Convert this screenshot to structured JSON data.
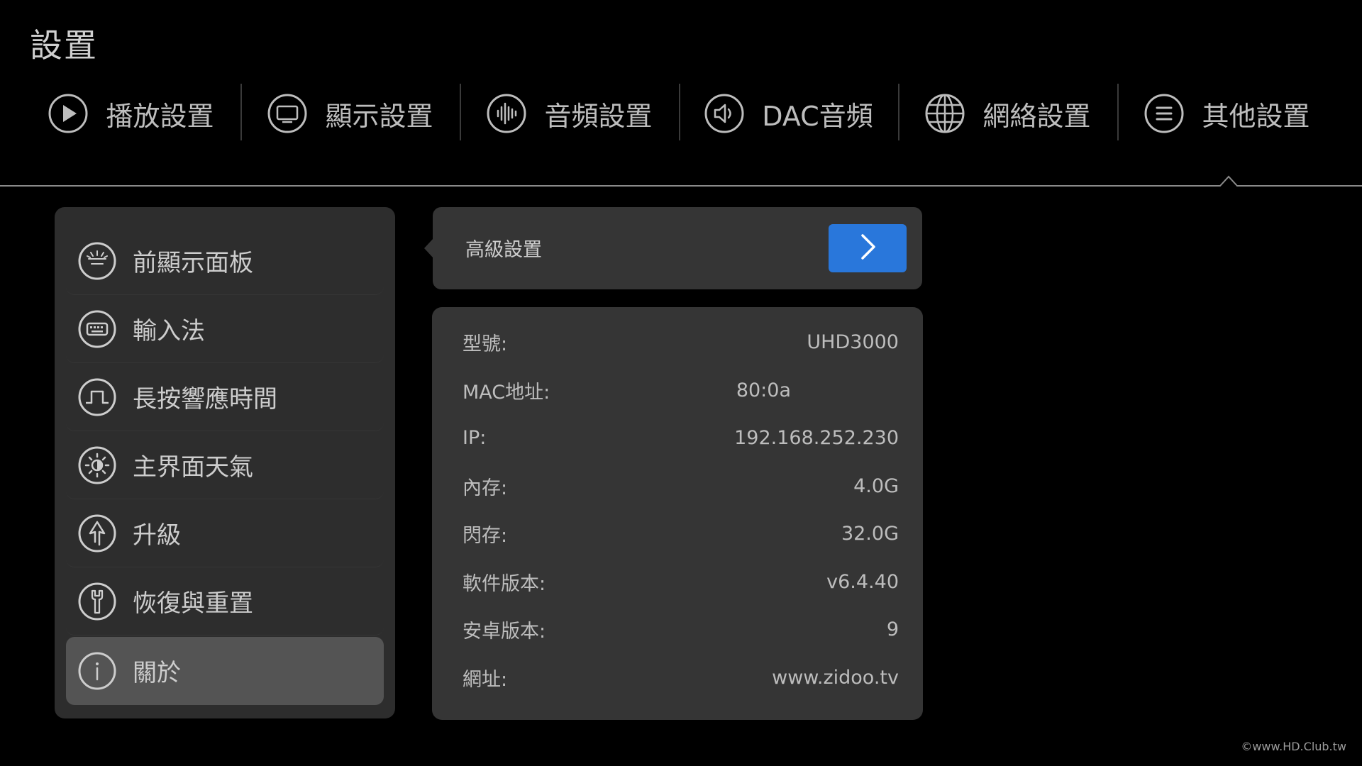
{
  "page_title": "設置",
  "tabs": [
    {
      "label": "播放設置",
      "icon": "play-icon"
    },
    {
      "label": "顯示設置",
      "icon": "monitor-icon"
    },
    {
      "label": "音頻設置",
      "icon": "audio-wave-icon"
    },
    {
      "label": "DAC音頻",
      "icon": "speaker-icon"
    },
    {
      "label": "網絡設置",
      "icon": "globe-icon"
    },
    {
      "label": "其他設置",
      "icon": "menu-icon"
    }
  ],
  "active_tab_index": 5,
  "menu": {
    "items": [
      {
        "label": "前顯示面板",
        "icon": "front-panel-icon"
      },
      {
        "label": "輸入法",
        "icon": "keyboard-icon"
      },
      {
        "label": "長按響應時間",
        "icon": "pulse-icon"
      },
      {
        "label": "主界面天氣",
        "icon": "weather-icon"
      },
      {
        "label": "升級",
        "icon": "upgrade-icon"
      },
      {
        "label": "恢復與重置",
        "icon": "wrench-icon"
      },
      {
        "label": "關於",
        "icon": "info-icon"
      }
    ],
    "active_index": 6
  },
  "advanced": {
    "label": "高級設置",
    "button_icon": "chevron-right-icon",
    "button_color": "#2977db"
  },
  "info": {
    "rows": [
      {
        "key": "型號:",
        "value": "UHD3000"
      },
      {
        "key": "MAC地址:",
        "value": "80:0a"
      },
      {
        "key": "IP:",
        "value": "192.168.252.230"
      },
      {
        "key": "內存:",
        "value": "4.0G"
      },
      {
        "key": "閃存:",
        "value": "32.0G"
      },
      {
        "key": "軟件版本:",
        "value": "v6.4.40"
      },
      {
        "key": "安卓版本:",
        "value": "9"
      },
      {
        "key": "網址:",
        "value": "www.zidoo.tv"
      }
    ]
  },
  "watermark": "©www.HD.Club.tw"
}
